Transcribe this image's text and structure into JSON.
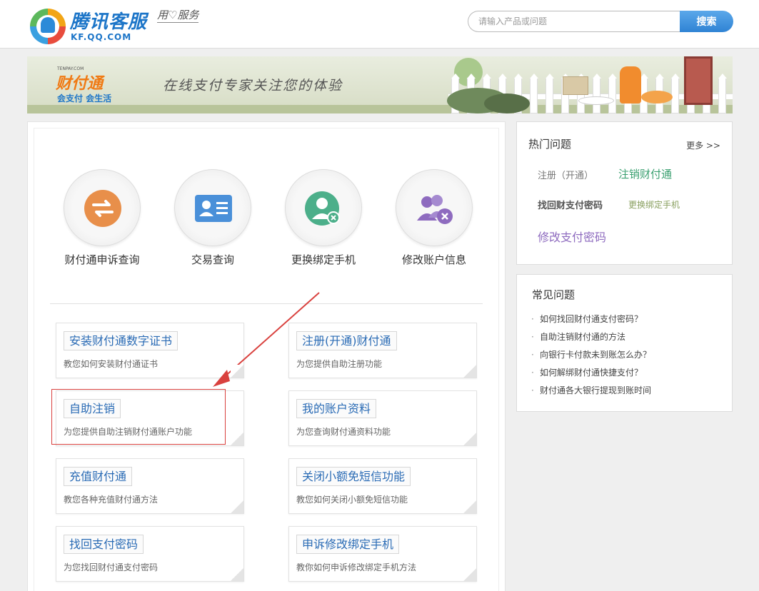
{
  "header": {
    "logo_title": "腾讯客服",
    "logo_url_text": "KF.QQ.COM",
    "logo_slogan": "用♡服务",
    "search_placeholder": "请输入产品或问题",
    "search_button": "搜索"
  },
  "banner": {
    "brand_small": "TENPAY.COM",
    "brand_name": "财付通",
    "brand_tagline": "会支付 会生活",
    "slogan": "在线支付专家关注您的体验"
  },
  "services": [
    {
      "label": "财付通申诉查询",
      "icon": "exchange-icon",
      "color": "#e88f4a"
    },
    {
      "label": "交易查询",
      "icon": "id-card-icon",
      "color": "#4a90d9"
    },
    {
      "label": "更换绑定手机",
      "icon": "user-remove-icon",
      "color": "#4caf8a"
    },
    {
      "label": "修改账户信息",
      "icon": "users-remove-icon",
      "color": "#8e6bbf"
    }
  ],
  "cards": [
    {
      "title": "安装财付通数字证书",
      "desc": "教您如何安装财付通证书"
    },
    {
      "title": "注册(开通)财付通",
      "desc": "为您提供自助注册功能"
    },
    {
      "title": "自助注销",
      "desc": "为您提供自助注销财付通账户功能"
    },
    {
      "title": "我的账户资料",
      "desc": "为您查询财付通资料功能"
    },
    {
      "title": "充值财付通",
      "desc": "教您各种充值财付通方法"
    },
    {
      "title": "关闭小额免短信功能",
      "desc": "教您如何关闭小额免短信功能"
    },
    {
      "title": "找回支付密码",
      "desc": "为您找回财付通支付密码"
    },
    {
      "title": "申诉修改绑定手机",
      "desc": "教你如何申诉修改绑定手机方法"
    }
  ],
  "hot": {
    "title": "热门问题",
    "more": "更多 >>",
    "links": [
      {
        "text": "注册（开通）",
        "color": "#777"
      },
      {
        "text": "注销财付通",
        "color": "#3aa070"
      },
      {
        "text": "找回财支付密码",
        "color": "#555"
      },
      {
        "text": "更换绑定手机",
        "color": "#8aa060"
      },
      {
        "text": "修改支付密码",
        "color": "#8e6bbf"
      }
    ]
  },
  "faq": {
    "title": "常见问题",
    "items": [
      "如何找回财付通支付密码？",
      "自助注销财付通的方法",
      "向银行卡付款未到账怎么办？",
      "如何解绑财付通快捷支付？",
      "财付通各大银行提现到账时间"
    ]
  }
}
